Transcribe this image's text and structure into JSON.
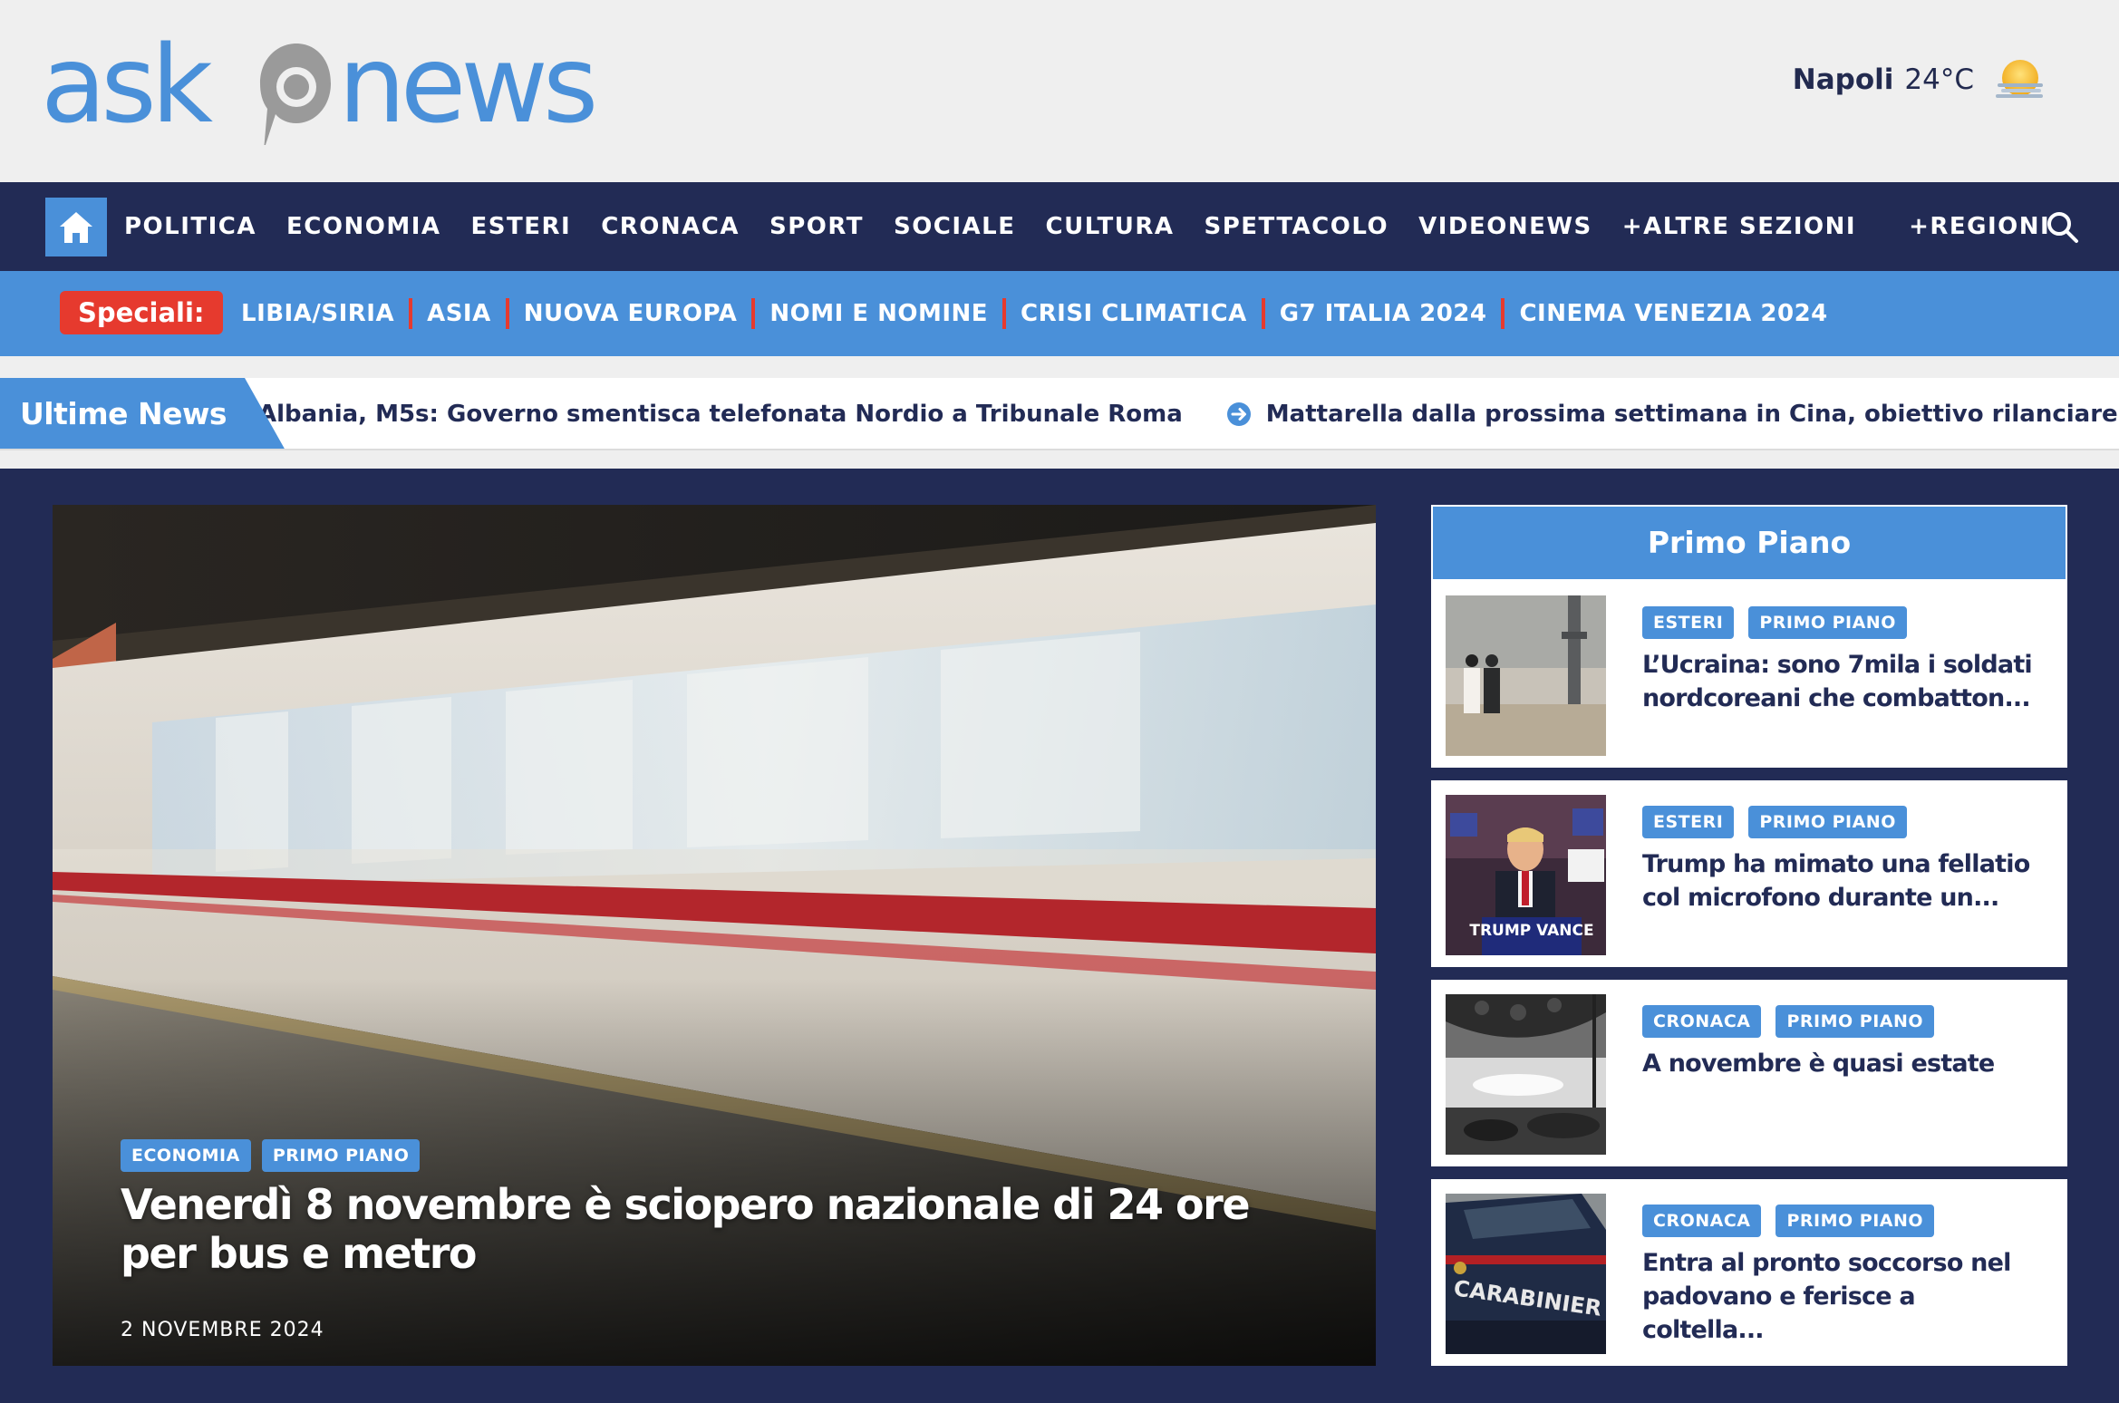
{
  "header": {
    "logo_text": "askanews",
    "weather": {
      "city": "Napoli",
      "temperature": "24°C",
      "icon": "sun-cloud-icon"
    }
  },
  "nav": {
    "items": [
      "POLITICA",
      "ECONOMIA",
      "ESTERI",
      "CRONACA",
      "SPORT",
      "SOCIALE",
      "CULTURA",
      "SPETTACOLO",
      "VIDEONEWS",
      "+ALTRE SEZIONI",
      "+REGIONI"
    ],
    "home_icon": "home-icon",
    "search_icon": "search-icon"
  },
  "speciali": {
    "label": "Speciali:",
    "items": [
      "LIBIA/SIRIA",
      "ASIA",
      "NUOVA EUROPA",
      "NOMI E NOMINE",
      "CRISI CLIMATICA",
      "G7 ITALIA 2024",
      "CINEMA VENEZIA 2024"
    ]
  },
  "ticker": {
    "label": "Ultime News",
    "items": [
      "Albania, M5s: Governo smentisca telefonata Nordio a Tribunale Roma",
      "Mattarella dalla prossima settimana in Cina, obiettivo rilanciare rapporti"
    ]
  },
  "hero": {
    "tags": [
      "ECONOMIA",
      "PRIMO PIANO"
    ],
    "title": "Venerdì 8 novembre è sciopero nazionale di 24 ore per bus e metro",
    "date": "2 NOVEMBRE 2024"
  },
  "primo_piano": {
    "header": "Primo Piano",
    "articles": [
      {
        "tags": [
          "ESTERI",
          "PRIMO PIANO"
        ],
        "title": "L’Ucraina: sono 7mila i soldati nordcoreani che combatton..."
      },
      {
        "tags": [
          "ESTERI",
          "PRIMO PIANO"
        ],
        "title": "Trump ha mimato una fellatio col microfono durante un..."
      },
      {
        "tags": [
          "CRONACA",
          "PRIMO PIANO"
        ],
        "title": "A novembre è quasi estate"
      },
      {
        "tags": [
          "CRONACA",
          "PRIMO PIANO"
        ],
        "title": "Entra al pronto soccorso nel padovano e ferisce a coltella..."
      }
    ]
  },
  "image_text": {
    "podium_sign": "TRUMP VANCE",
    "car_lettering": "CARABINIER"
  },
  "colors": {
    "navy": "#222b55",
    "blue": "#4a90d9",
    "red": "#e63a2e",
    "background": "#efefef"
  }
}
